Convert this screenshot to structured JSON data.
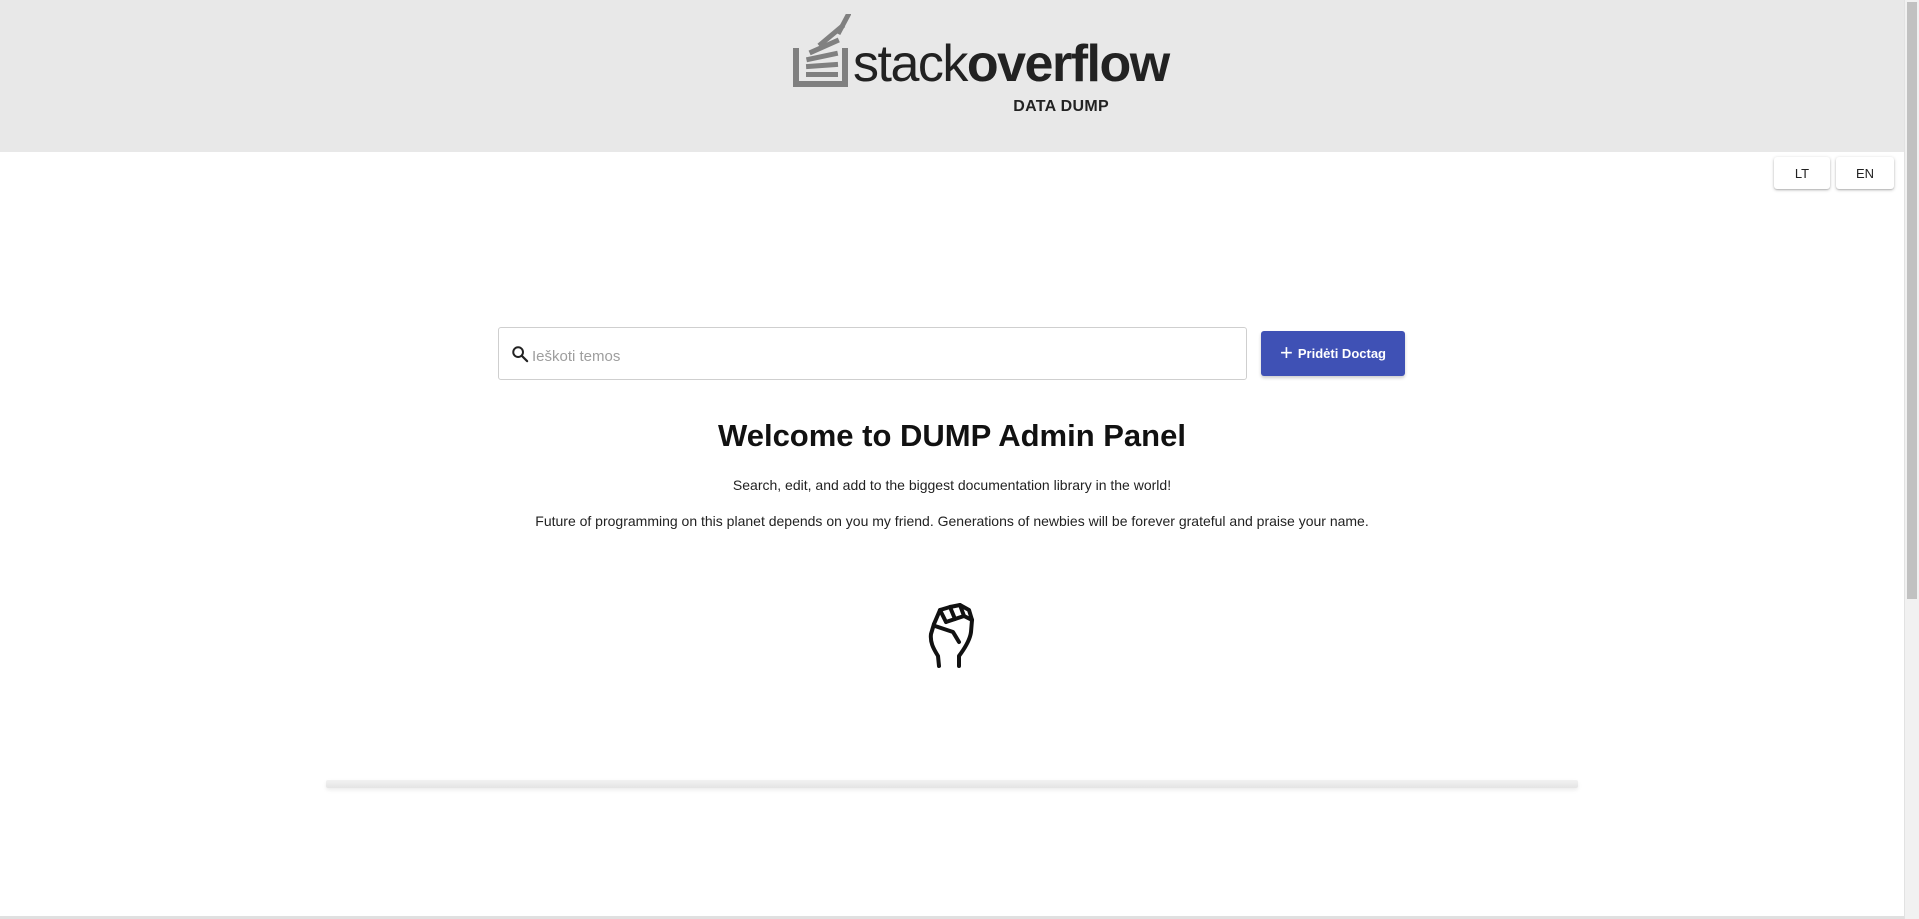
{
  "logo": {
    "word_light": "stack",
    "word_bold": "overflow",
    "sub": "DATA DUMP"
  },
  "language": {
    "lt_label": "LT",
    "en_label": "EN"
  },
  "search": {
    "placeholder": "Ieškoti temos",
    "value": ""
  },
  "add_button": {
    "label": "Pridėti Doctag"
  },
  "welcome": {
    "title": "Welcome to DUMP Admin Panel",
    "line1": "Search, edit, and add to the biggest documentation library in the world!",
    "line2": "Future of programming on this planet depends on you my friend. Generations of newbies will be forever grateful and praise your name."
  },
  "icons": {
    "search": "search-icon",
    "add": "plus-icon",
    "fist": "raised-fist-icon",
    "logo": "stack-icon"
  },
  "colors": {
    "accent": "#3f51b5",
    "header_bg": "#e8e8e8",
    "logo_orange_replaced_gray": "#808080"
  }
}
